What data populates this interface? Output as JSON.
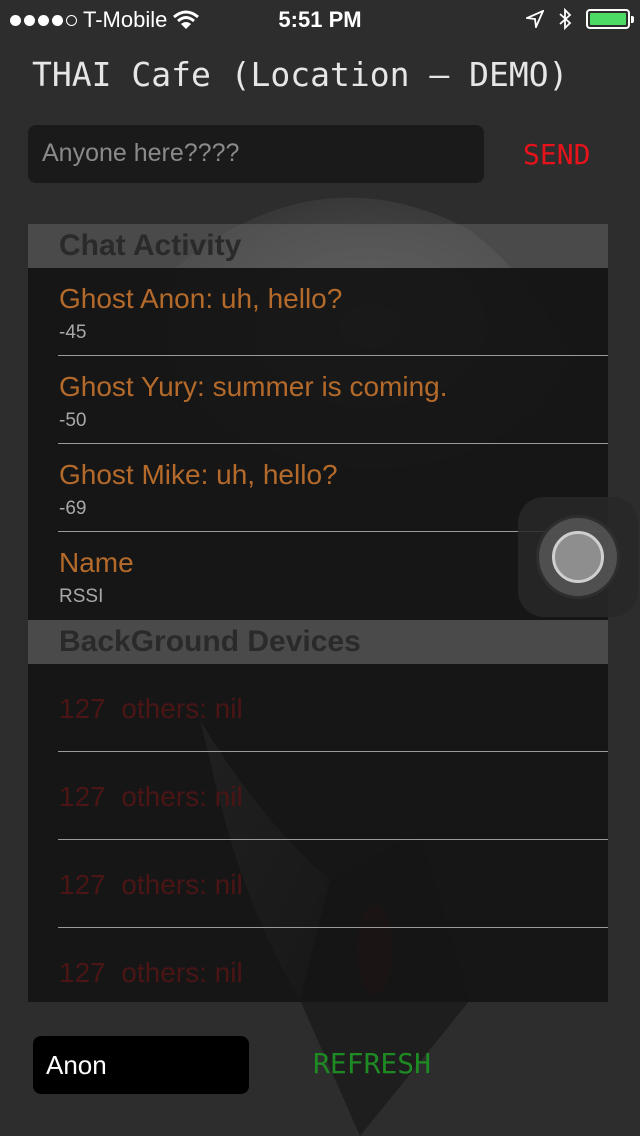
{
  "status_bar": {
    "carrier": "T-Mobile",
    "time": "5:51 PM",
    "signal_dots_filled": 4,
    "signal_dots_total": 5,
    "battery_level": 1.0,
    "battery_color": "#4cd964"
  },
  "header": {
    "title": "THAI Cafe (Location – DEMO)"
  },
  "compose": {
    "placeholder": "Anyone here????",
    "send_label": "SEND"
  },
  "chat_section": {
    "header": "Chat Activity",
    "items": [
      {
        "title": "Ghost Anon: uh, hello?",
        "subtitle": "-45"
      },
      {
        "title": "Ghost Yury: summer is coming.",
        "subtitle": "-50"
      },
      {
        "title": "Ghost Mike: uh, hello?",
        "subtitle": "-69"
      },
      {
        "title": "Name",
        "subtitle": "RSSI"
      }
    ]
  },
  "devices_section": {
    "header": "BackGround Devices",
    "items": [
      {
        "title": "127  others: nil"
      },
      {
        "title": "127  others: nil"
      },
      {
        "title": "127  others: nil"
      },
      {
        "title": "127  others: nil"
      }
    ]
  },
  "footer": {
    "name_value": "Anon",
    "refresh_label": "REFRESH"
  },
  "colors": {
    "send": "#e8121b",
    "refresh": "#1e8a24",
    "chat_text": "#b46a2a",
    "device_text": "#4c1515"
  },
  "icons": [
    "wifi-icon",
    "location-arrow-icon",
    "bluetooth-icon",
    "battery-icon",
    "assistive-touch-icon"
  ]
}
